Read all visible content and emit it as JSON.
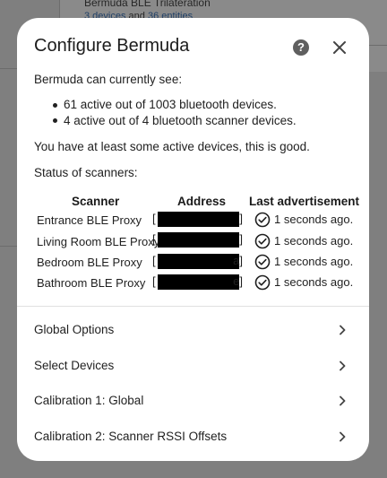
{
  "background": {
    "integration_title": "Bermuda BLE Trilateration",
    "devices_link": "3 devices",
    "and_text": "and",
    "entities_link": "36 entities"
  },
  "dialog": {
    "title": "Configure Bermuda",
    "help_icon": "help-icon",
    "close_icon": "close-icon",
    "intro": "Bermuda can currently see:",
    "bullets": [
      "61 active out of 1003 bluetooth devices.",
      "4 active out of 4 bluetooth scanner devices."
    ],
    "status_message": "You have at least some active devices, this is good.",
    "scanners_heading": "Status of scanners:",
    "table": {
      "headers": [
        "Scanner",
        "Address",
        "Last advertisement"
      ],
      "rows": [
        {
          "scanner": "Entrance BLE Proxy",
          "addr_open": "[",
          "addr_close": "]",
          "last": "1 seconds ago."
        },
        {
          "scanner": "Living Room BLE Proxy",
          "addr_open": "[",
          "addr_close": "]",
          "last": "1 seconds ago."
        },
        {
          "scanner": "Bedroom BLE Proxy",
          "addr_open": "[",
          "addr_close": "a]",
          "last": "1 seconds ago."
        },
        {
          "scanner": "Bathroom BLE Proxy",
          "addr_open": "[",
          "addr_close": "e]",
          "last": "1 seconds ago."
        }
      ]
    },
    "menu": [
      {
        "label": "Global Options"
      },
      {
        "label": "Select Devices"
      },
      {
        "label": "Calibration 1: Global"
      },
      {
        "label": "Calibration 2: Scanner RSSI Offsets"
      }
    ]
  },
  "colors": {
    "overlay": "#7f7f7f",
    "dialog_bg": "#ffffff",
    "text": "#212121",
    "link": "#1f3f66"
  }
}
